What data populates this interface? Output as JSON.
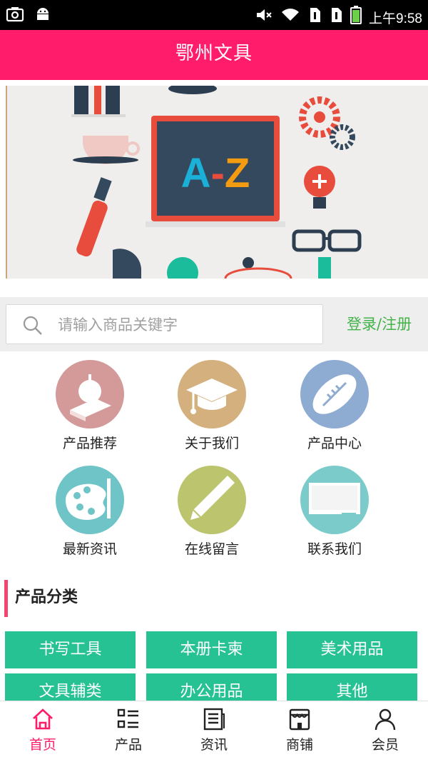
{
  "status_bar": {
    "time": "上午9:58",
    "icons": [
      "camera-icon",
      "android-icon",
      "mute-icon",
      "wifi-icon",
      "sim1-icon",
      "sim2-icon",
      "battery-icon"
    ]
  },
  "app_bar": {
    "title": "鄂州文具"
  },
  "banner": {
    "text": "A-Z",
    "active_dot": 2,
    "dot_count": 3
  },
  "search": {
    "placeholder": "请输入商品关键字",
    "login_label": "登录/注册"
  },
  "menu": [
    {
      "label": "产品推荐",
      "icon": "apple-book-icon",
      "color": "#d49a9a"
    },
    {
      "label": "关于我们",
      "icon": "graduation-cap-icon",
      "color": "#d3b07e"
    },
    {
      "label": "产品中心",
      "icon": "football-icon",
      "color": "#8eacd1"
    },
    {
      "label": "最新资讯",
      "icon": "palette-icon",
      "color": "#6ec4c6"
    },
    {
      "label": "在线留言",
      "icon": "pencil-icon",
      "color": "#bcc46e"
    },
    {
      "label": "联系我们",
      "icon": "whiteboard-icon",
      "color": "#7ccbcb"
    }
  ],
  "categories": {
    "title": "产品分类",
    "items": [
      "书写工具",
      "本册卡柬",
      "美术用品",
      "文具辅类",
      "办公用品",
      "其他"
    ]
  },
  "tabs": [
    {
      "label": "首页",
      "icon": "home-icon",
      "active": true
    },
    {
      "label": "产品",
      "icon": "list-icon",
      "active": false
    },
    {
      "label": "资讯",
      "icon": "news-icon",
      "active": false
    },
    {
      "label": "商铺",
      "icon": "store-icon",
      "active": false
    },
    {
      "label": "会员",
      "icon": "user-icon",
      "active": false
    }
  ],
  "colors": {
    "brand": "#ff1c6b",
    "accent_green": "#26c293",
    "login_green": "#43b249",
    "section_bar": "#f24570"
  }
}
